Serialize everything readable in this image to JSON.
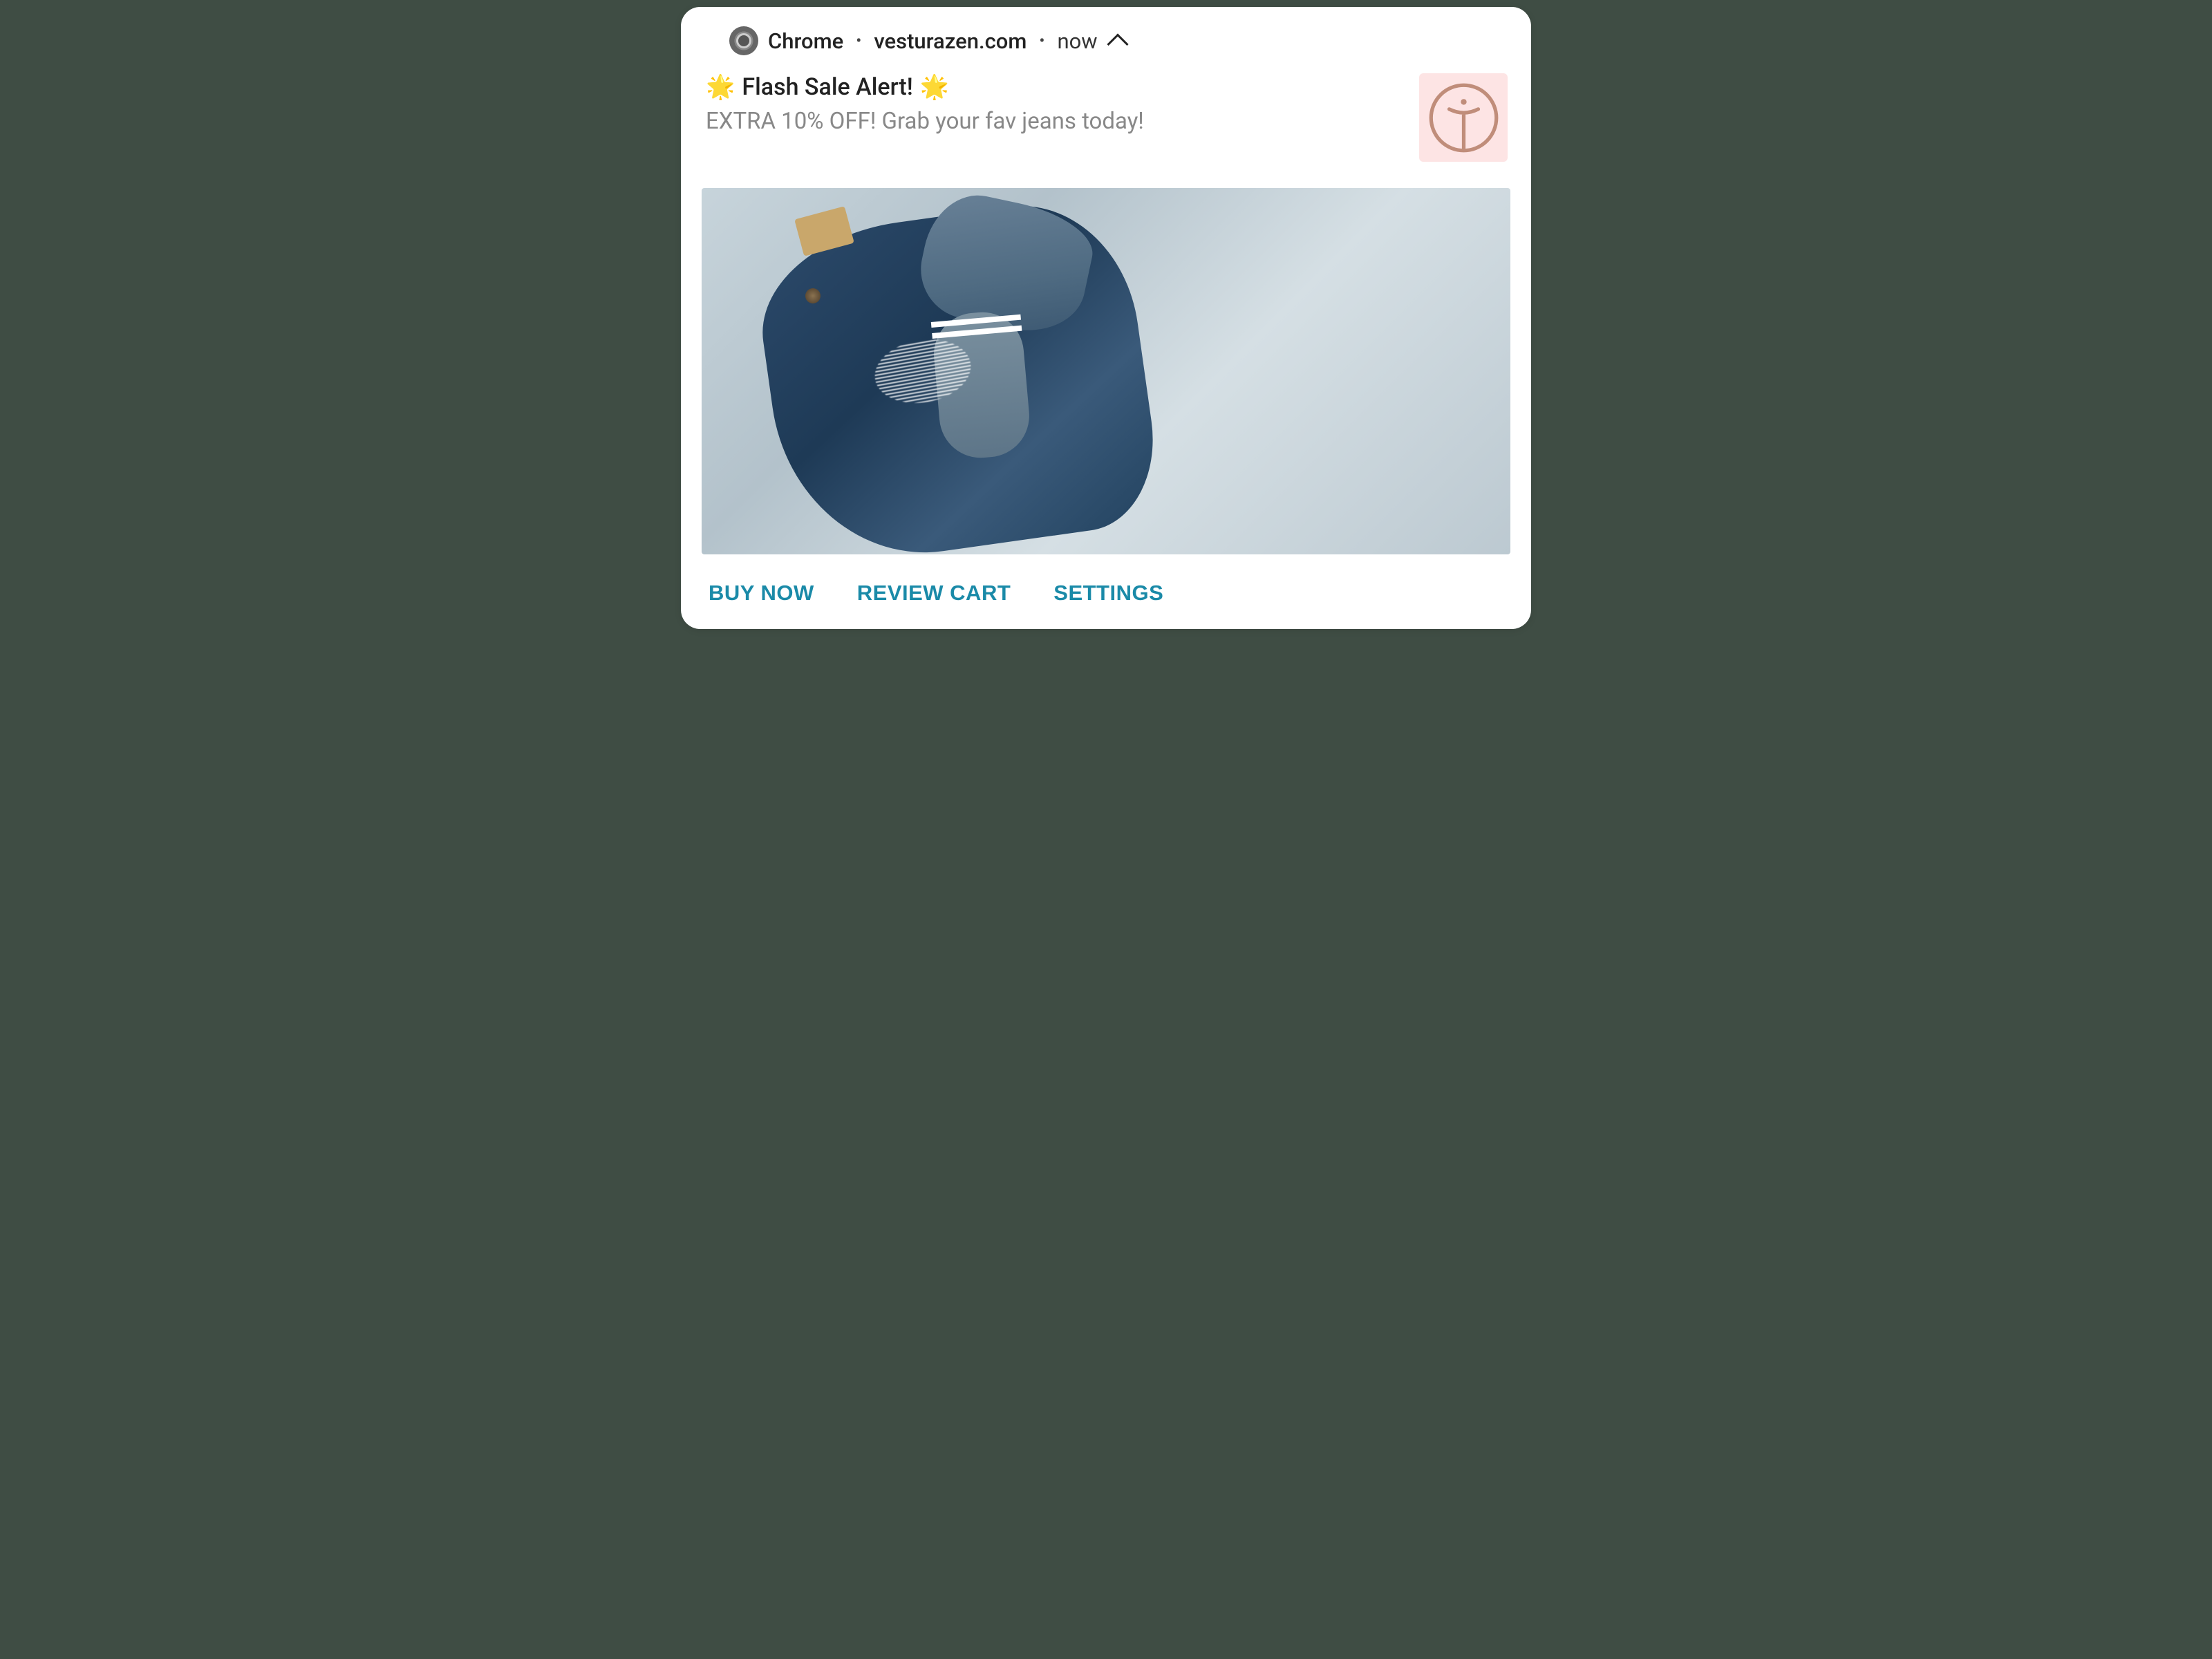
{
  "header": {
    "app_name": "Chrome",
    "domain": "vesturazen.com",
    "time_label": "now"
  },
  "content": {
    "title_prefix_emoji": "🌟",
    "title_text": "Flash Sale Alert!",
    "title_suffix_emoji": "🌟",
    "body": "EXTRA 10% OFF! Grab your fav jeans today!"
  },
  "actions": {
    "buy_now": "BUY NOW",
    "review_cart": "REVIEW CART",
    "settings": "SETTINGS"
  },
  "colors": {
    "action_color": "#1a8aa8",
    "body_text_color": "#888"
  }
}
